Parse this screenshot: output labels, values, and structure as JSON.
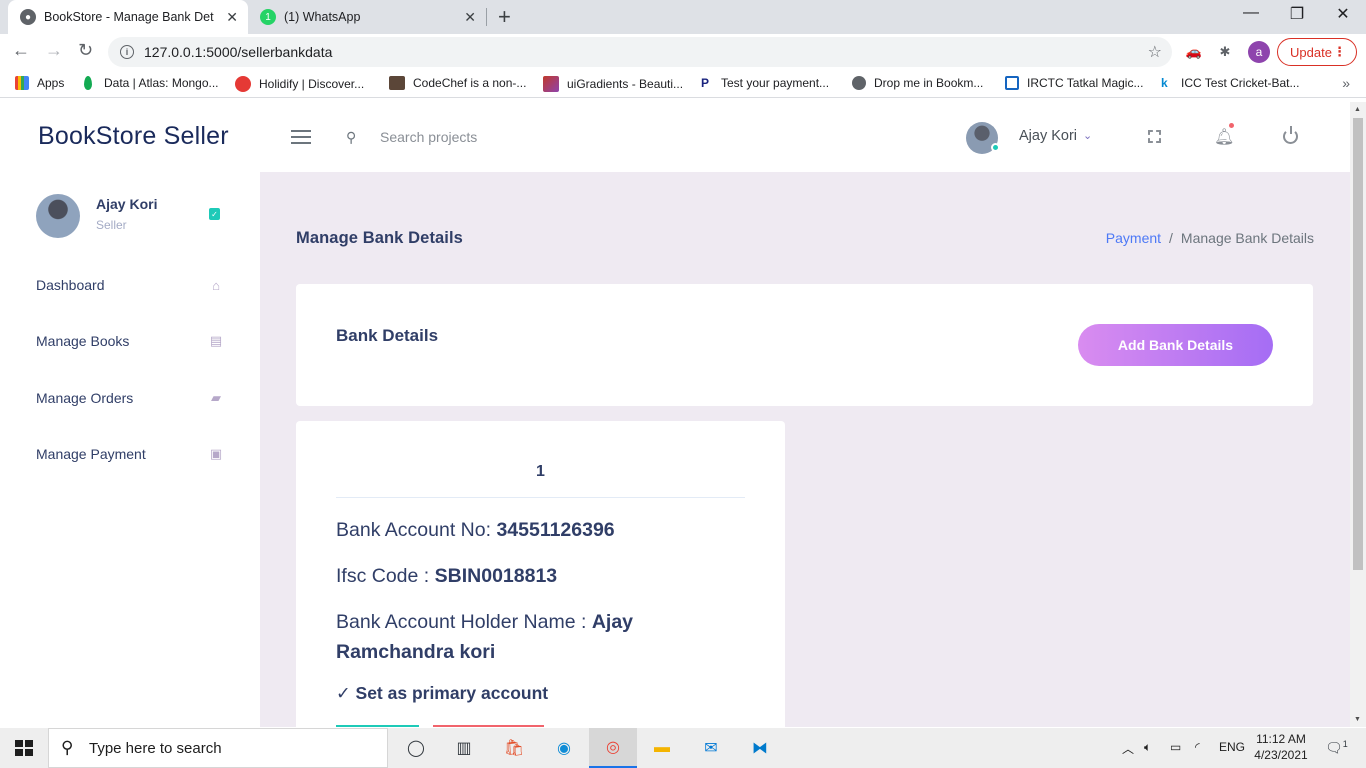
{
  "browser": {
    "tabs": [
      {
        "title": "BookStore - Manage Bank Details",
        "favicon": "globe-icon"
      },
      {
        "title": "(1) WhatsApp",
        "favicon": "whatsapp-icon"
      }
    ],
    "url": "127.0.0.1:5000/sellerbankdata",
    "update_label": "Update",
    "profile_initial": "a",
    "bookmarks": [
      {
        "label": "Apps",
        "color": "#4285f4"
      },
      {
        "label": "Data | Atlas: Mongo...",
        "color": "#13aa52"
      },
      {
        "label": "Holidify | Discover...",
        "color": "#e53935"
      },
      {
        "label": "CodeChef is a non-...",
        "color": "#5b4638"
      },
      {
        "label": "uiGradients - Beauti...",
        "color": "#8e44ad"
      },
      {
        "label": "Test your payment...",
        "color": "#1a237e"
      },
      {
        "label": "Drop me in Bookm...",
        "color": "#5f6368"
      },
      {
        "label": "IRCTC Tatkal Magic...",
        "color": "#1565c0"
      },
      {
        "label": "ICC Test Cricket-Bat...",
        "color": "#0288d1"
      }
    ]
  },
  "topnav": {
    "brand": "BookStore Seller",
    "search_placeholder": "Search projects",
    "user_name": "Ajay Kori"
  },
  "sidebar": {
    "user_name": "Ajay Kori",
    "user_role": "Seller",
    "items": [
      {
        "label": "Dashboard",
        "icon": "home-icon"
      },
      {
        "label": "Manage Books",
        "icon": "books-icon"
      },
      {
        "label": "Manage Orders",
        "icon": "truck-icon"
      },
      {
        "label": "Manage Payment",
        "icon": "money-icon"
      }
    ]
  },
  "main": {
    "page_title": "Manage Bank Details",
    "breadcrumb": {
      "parent": "Payment",
      "separator": "/",
      "current": "Manage Bank Details"
    },
    "card_title": "Bank Details",
    "add_button": "Add Bank Details",
    "account": {
      "index": "1",
      "account_no_label": "Bank Account No:",
      "account_no": "34551126396",
      "ifsc_label": "Ifsc Code :",
      "ifsc": "SBIN0018813",
      "holder_label": "Bank Account Holder Name :",
      "holder": "Ajay Ramchandra kori",
      "primary_label": "✓ Set as primary account"
    }
  },
  "taskbar": {
    "search_text": "Type here to search",
    "lang": "ENG",
    "time": "11:12 AM",
    "date": "4/23/2021",
    "notification_count": "1"
  },
  "colors": {
    "brand": "#1a2a5b",
    "content_bg": "#efeaf2",
    "accent_link": "#4d79f6",
    "button_gradient_start": "#d98cf0",
    "button_gradient_end": "#a56df4",
    "success": "#1ecab8",
    "danger": "#f1646c"
  }
}
